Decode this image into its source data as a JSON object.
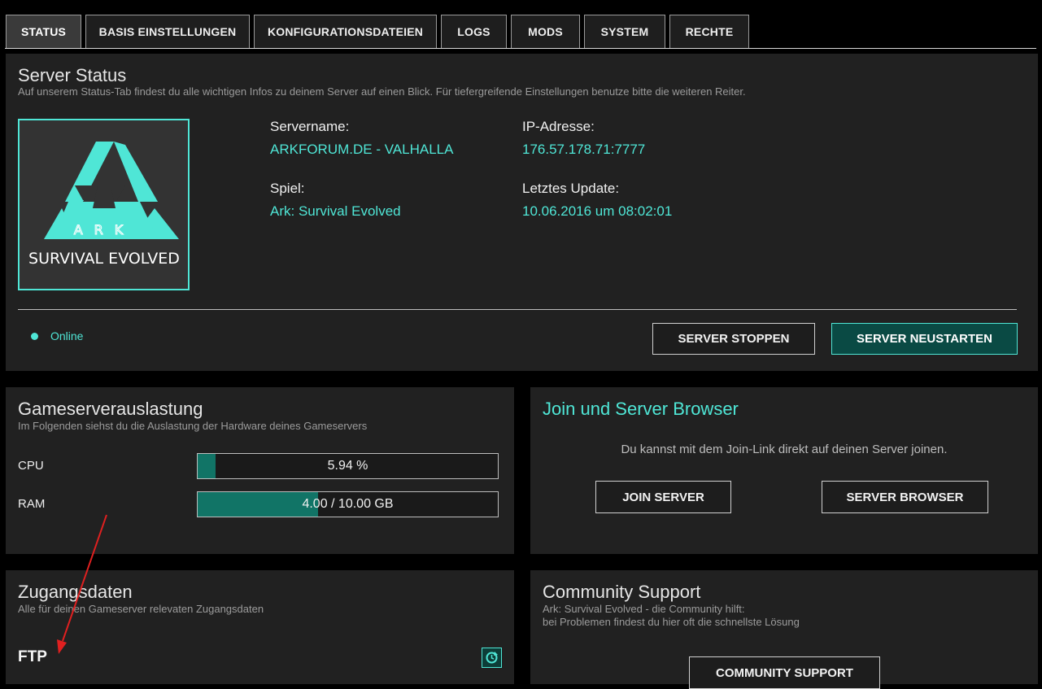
{
  "tabs": [
    {
      "label": "STATUS",
      "active": true
    },
    {
      "label": "BASIS EINSTELLUNGEN",
      "active": false
    },
    {
      "label": "KONFIGURATIONSDATEIEN",
      "active": false
    },
    {
      "label": "LOGS",
      "active": false
    },
    {
      "label": "MODS",
      "active": false
    },
    {
      "label": "SYSTEM",
      "active": false
    },
    {
      "label": "RECHTE",
      "active": false
    }
  ],
  "server_status": {
    "title": "Server Status",
    "subtitle": "Auf unserem Status-Tab findest du alle wichtigen Infos zu deinem Server auf einen Blick. Für tiefergreifende Einstellungen benutze bitte die weiteren Reiter.",
    "logo": {
      "top_text": "ARK",
      "bottom_text": "SURVIVAL EVOLVED"
    },
    "servername_label": "Servername:",
    "servername_value": "ARKFORUM.DE - VALHALLA",
    "ip_label": "IP-Adresse:",
    "ip_value": "176.57.178.71:7777",
    "game_label": "Spiel:",
    "game_value": "Ark: Survival Evolved",
    "update_label": "Letztes Update:",
    "update_value": "10.06.2016 um 08:02:01",
    "online_text": "Online",
    "stop_button": "SERVER STOPPEN",
    "restart_button": "SERVER NEUSTARTEN"
  },
  "load": {
    "title": "Gameserverauslastung",
    "subtitle": "Im Folgenden siehst du die Auslastung der Hardware deines Gameservers",
    "cpu_label": "CPU",
    "cpu_text": "5.94 %",
    "cpu_fraction": 0.0594,
    "ram_label": "RAM",
    "ram_text": "4.00 / 10.00 GB",
    "ram_fraction": 0.4
  },
  "join": {
    "title": "Join und Server Browser",
    "text": "Du kannst mit dem Join-Link direkt auf deinen Server joinen.",
    "join_button": "JOIN SERVER",
    "browser_button": "SERVER BROWSER"
  },
  "access": {
    "title": "Zugangsdaten",
    "subtitle": "Alle für deinen Gameserver relevaten Zugangsdaten",
    "ftp_label": "FTP"
  },
  "community": {
    "title": "Community Support",
    "line1": "Ark: Survival Evolved - die Community hilft:",
    "line2": "bei Problemen findest du hier oft die schnellste Lösung",
    "button": "COMMUNITY SUPPORT"
  },
  "colors": {
    "accent": "#4fe6d6",
    "panel": "#212121",
    "background": "#000000",
    "bar_fill": "#117466",
    "annotation_arrow": "#e02020"
  }
}
